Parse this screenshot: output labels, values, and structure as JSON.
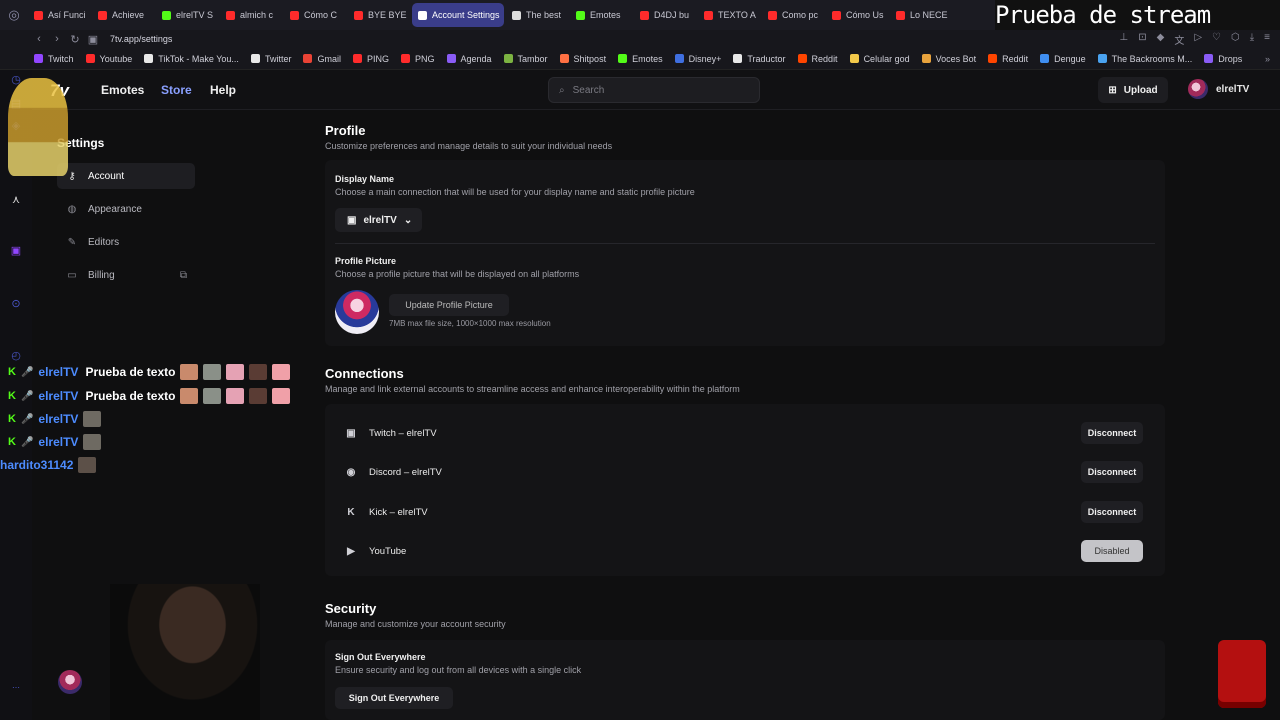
{
  "browser": {
    "tabs": [
      {
        "label": "Así Funci",
        "color": "#ff2b2b"
      },
      {
        "label": "Achieve",
        "color": "#ff2b2b"
      },
      {
        "label": "elrelTV S",
        "color": "#53fc18"
      },
      {
        "label": "almich c",
        "color": "#ff2b2b"
      },
      {
        "label": "Cómo C",
        "color": "#ff2b2b"
      },
      {
        "label": "BYE BYE",
        "color": "#ff2b2b"
      },
      {
        "label": "Account Settings",
        "color": "#ffffff",
        "active": true
      },
      {
        "label": "The best",
        "color": "#dddddd"
      },
      {
        "label": "Emotes",
        "color": "#53fc18"
      },
      {
        "label": "D4DJ bu",
        "color": "#ff2b2b"
      },
      {
        "label": "TEXTO A",
        "color": "#ff2b2b"
      },
      {
        "label": "Como pc",
        "color": "#ff2b2b"
      },
      {
        "label": "Cómo Us",
        "color": "#ff2b2b"
      },
      {
        "label": "Lo NECE",
        "color": "#ff2b2b"
      }
    ],
    "stream_overlay_text": "Prueba de stream",
    "url": "7tv.app/settings",
    "bookmarks": [
      {
        "label": "Twitch",
        "color": "#9146ff"
      },
      {
        "label": "Youtube",
        "color": "#ff2b2b"
      },
      {
        "label": "TikTok - Make You...",
        "color": "#e8e8e8"
      },
      {
        "label": "Twitter",
        "color": "#e8e8e8"
      },
      {
        "label": "Gmail",
        "color": "#ea4335"
      },
      {
        "label": "PING",
        "color": "#ff2b2b"
      },
      {
        "label": "PNG",
        "color": "#ff2b2b"
      },
      {
        "label": "Agenda",
        "color": "#8a5cf6"
      },
      {
        "label": "Tambor",
        "color": "#7cb342"
      },
      {
        "label": "Shitpost",
        "color": "#ff7043"
      },
      {
        "label": "Emotes",
        "color": "#53fc18"
      },
      {
        "label": "Disney+",
        "color": "#3f6fe0"
      },
      {
        "label": "Traductor",
        "color": "#e8e8e8"
      },
      {
        "label": "Reddit",
        "color": "#ff4500"
      },
      {
        "label": "Celular god",
        "color": "#f3c94a"
      },
      {
        "label": "Voces Bot",
        "color": "#e8a33d"
      },
      {
        "label": "Reddit",
        "color": "#ff4500"
      },
      {
        "label": "Dengue",
        "color": "#3f8ef0"
      },
      {
        "label": "The Backrooms M...",
        "color": "#4aa3f0"
      },
      {
        "label": "Drops",
        "color": "#8a5cf6"
      }
    ]
  },
  "header": {
    "logo": "7v",
    "nav": {
      "emotes": "Emotes",
      "store": "Store",
      "help": "Help"
    },
    "search_placeholder": "Search",
    "upload": "Upload",
    "username": "elrelTV"
  },
  "sidebar": {
    "title": "Settings",
    "items": [
      {
        "label": "Account",
        "icon": "key-icon",
        "active": true
      },
      {
        "label": "Appearance",
        "icon": "palette-icon"
      },
      {
        "label": "Editors",
        "icon": "pencil-icon"
      },
      {
        "label": "Billing",
        "icon": "credit-card-icon",
        "external": true
      }
    ]
  },
  "profile": {
    "title": "Profile",
    "subtitle": "Customize preferences and manage details to suit your individual needs",
    "display_name": {
      "label": "Display Name",
      "description": "Choose a main connection that will be used for your display name and static profile picture",
      "selected": "elrelTV"
    },
    "profile_picture": {
      "label": "Profile Picture",
      "description": "Choose a profile picture that will be displayed on all platforms",
      "button": "Update Profile Picture",
      "note": "7MB max file size, 1000×1000 max resolution"
    }
  },
  "connections": {
    "title": "Connections",
    "subtitle": "Manage and link external accounts to streamline access and enhance interoperability within the platform",
    "items": [
      {
        "label": "Twitch – elrelTV",
        "icon": "twitch-icon",
        "button": "Disconnect"
      },
      {
        "label": "Discord – elrelTV",
        "icon": "discord-icon",
        "button": "Disconnect"
      },
      {
        "label": "Kick – elrelTV",
        "icon": "kick-icon",
        "button": "Disconnect"
      },
      {
        "label": "YouTube",
        "icon": "youtube-icon",
        "button": "Disabled",
        "disabled": true
      }
    ]
  },
  "security": {
    "title": "Security",
    "subtitle": "Manage and customize your account security",
    "signout": {
      "label": "Sign Out Everywhere",
      "description": "Ensure security and log out from all devices with a single click",
      "button": "Sign Out Everywhere"
    }
  },
  "overlay_chat": [
    {
      "user": "elrelTV",
      "message": "Prueba de texto",
      "emotes": 5
    },
    {
      "user": "elrelTV",
      "message": "Prueba de texto",
      "emotes": 5
    },
    {
      "user": "elrelTV",
      "message": "",
      "emotes": 1
    },
    {
      "user": "elrelTV",
      "message": "",
      "emotes": 1
    },
    {
      "user": "hardito31142",
      "message": "",
      "emotes": 1
    }
  ]
}
